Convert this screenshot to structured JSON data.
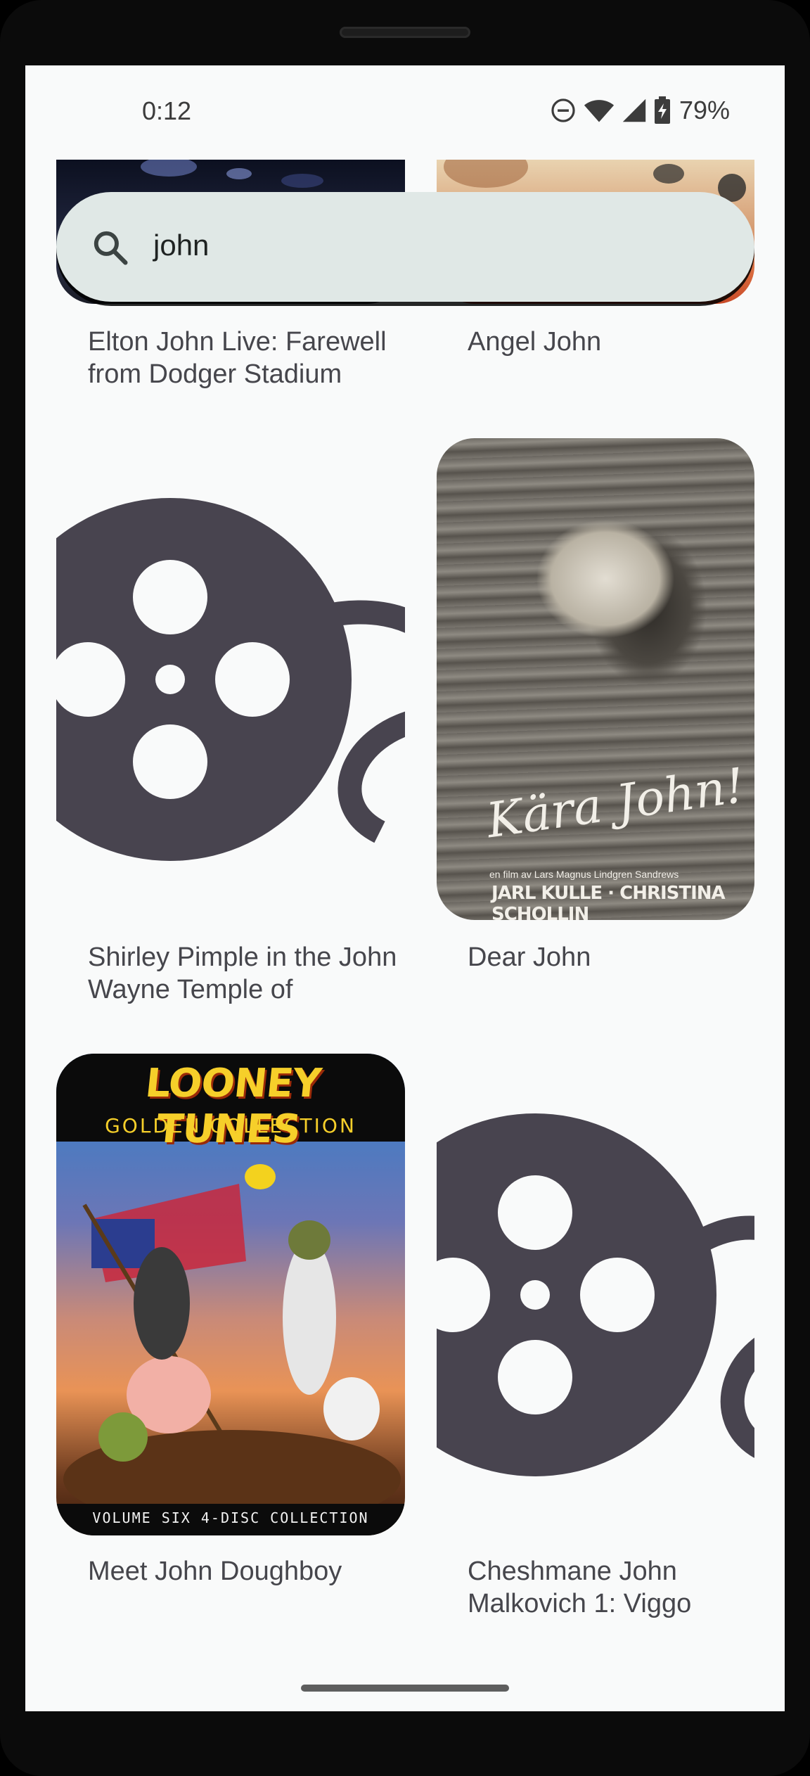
{
  "status_bar": {
    "time": "0:12",
    "battery_percent": "79%",
    "icons": [
      "do-not-disturb-icon",
      "wifi-icon",
      "signal-icon",
      "battery-charging-icon"
    ]
  },
  "search": {
    "query": "john",
    "icon": "search-icon"
  },
  "results": [
    {
      "title": "Elton John Live: Farewell from Dodger Stadium",
      "poster": "photo"
    },
    {
      "title": "Angel John",
      "poster": "photo"
    },
    {
      "title": "Shirley Pimple in the John Wayne Temple of",
      "poster": "film-reel-placeholder"
    },
    {
      "title": "Dear John",
      "poster": "photo",
      "poster_text": {
        "script": "Kära John!",
        "credits": "en film av Lars Magnus Lindgren   Sandrews",
        "cast": "JARL KULLE · CHRISTINA SCHOLLIN"
      }
    },
    {
      "title": "Meet John Doughboy",
      "poster": "photo",
      "poster_text": {
        "title": "LOONEY TUNES",
        "subtitle": "GOLDEN COLLECTION",
        "footer": "VOLUME SIX  4-DISC COLLECTION"
      }
    },
    {
      "title": "Cheshmane John Malkovich 1: Viggo",
      "poster": "film-reel-placeholder"
    }
  ],
  "colors": {
    "screen_bg": "#f9fafa",
    "search_bg": "#e0e8e6",
    "placeholder_icon": "#48444f",
    "title_text": "#46464c"
  }
}
